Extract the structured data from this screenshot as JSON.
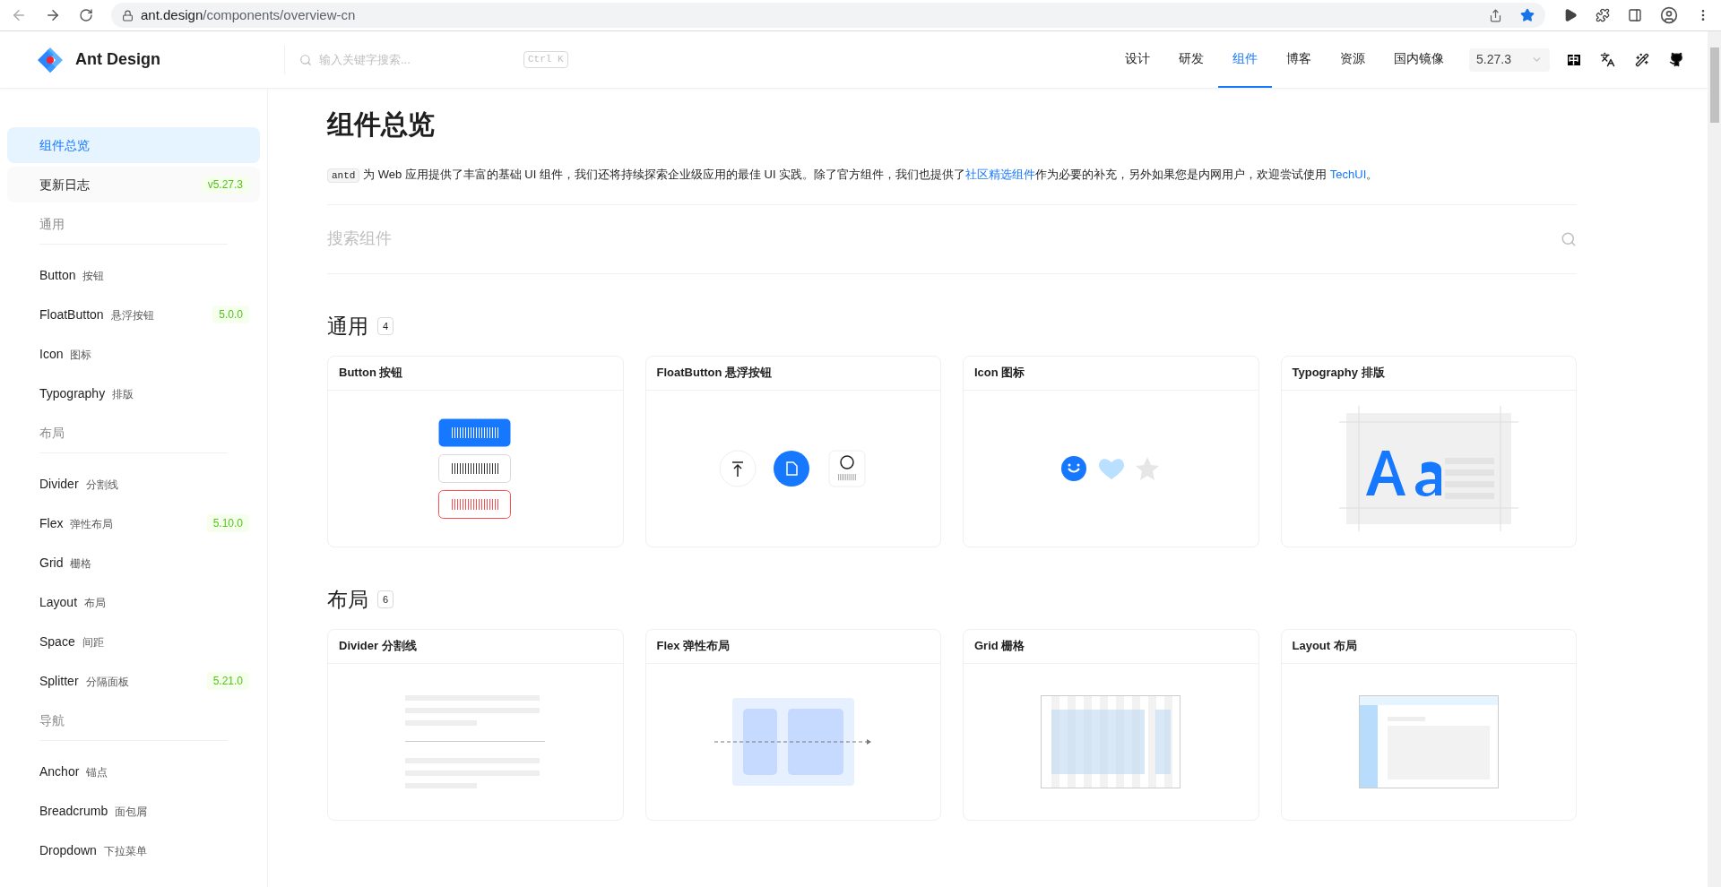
{
  "browser": {
    "url_host": "ant.design",
    "url_path": "/components/overview-cn"
  },
  "header": {
    "logo": "Ant Design",
    "search_placeholder": "输入关键字搜索...",
    "shortcut": "Ctrl K",
    "nav": [
      {
        "label": "设计",
        "selected": false
      },
      {
        "label": "研发",
        "selected": false
      },
      {
        "label": "组件",
        "selected": true
      },
      {
        "label": "博客",
        "selected": false
      },
      {
        "label": "资源",
        "selected": false
      },
      {
        "label": "国内镜像",
        "selected": false
      }
    ],
    "version": "5.27.3",
    "lang_glyph": "中"
  },
  "sidebar": {
    "items": [
      {
        "kind": "item",
        "label": "组件总览",
        "selected": true
      },
      {
        "kind": "item",
        "label": "更新日志",
        "badge": "v5.27.3",
        "selected": false
      },
      {
        "kind": "group",
        "label": "通用"
      },
      {
        "kind": "item",
        "label": "Button",
        "sub": "按钮",
        "selected": false
      },
      {
        "kind": "item",
        "label": "FloatButton",
        "sub": "悬浮按钮",
        "badge": "5.0.0",
        "selected": false
      },
      {
        "kind": "item",
        "label": "Icon",
        "sub": "图标",
        "selected": false
      },
      {
        "kind": "item",
        "label": "Typography",
        "sub": "排版",
        "selected": false
      },
      {
        "kind": "group",
        "label": "布局"
      },
      {
        "kind": "item",
        "label": "Divider",
        "sub": "分割线",
        "selected": false
      },
      {
        "kind": "item",
        "label": "Flex",
        "sub": "弹性布局",
        "badge": "5.10.0",
        "selected": false
      },
      {
        "kind": "item",
        "label": "Grid",
        "sub": "栅格",
        "selected": false
      },
      {
        "kind": "item",
        "label": "Layout",
        "sub": "布局",
        "selected": false
      },
      {
        "kind": "item",
        "label": "Space",
        "sub": "间距",
        "selected": false
      },
      {
        "kind": "item",
        "label": "Splitter",
        "sub": "分隔面板",
        "badge": "5.21.0",
        "selected": false
      },
      {
        "kind": "group",
        "label": "导航"
      },
      {
        "kind": "item",
        "label": "Anchor",
        "sub": "锚点",
        "selected": false
      },
      {
        "kind": "item",
        "label": "Breadcrumb",
        "sub": "面包屑",
        "selected": false
      },
      {
        "kind": "item",
        "label": "Dropdown",
        "sub": "下拉菜单",
        "selected": false
      }
    ]
  },
  "content": {
    "title": "组件总览",
    "description": [
      {
        "kind": "code",
        "text": "antd"
      },
      {
        "kind": "text",
        "text": " 为 Web 应用提供了丰富的基础 UI 组件，我们还将持续探索企业级应用的最佳 UI 实践。除了官方组件，我们也提供了"
      },
      {
        "kind": "link",
        "text": "社区精选组件"
      },
      {
        "kind": "text",
        "text": "作为必要的补充，另外如果您是内网用户，欢迎尝试使用 "
      },
      {
        "kind": "link",
        "text": "TechUI"
      },
      {
        "kind": "text",
        "text": "。"
      }
    ],
    "search_placeholder": "搜索组件",
    "sections": [
      {
        "title": "通用",
        "count": "4",
        "cards": [
          {
            "title": "Button 按钮",
            "kind": "button"
          },
          {
            "title": "FloatButton 悬浮按钮",
            "kind": "floatbutton"
          },
          {
            "title": "Icon 图标",
            "kind": "icon"
          },
          {
            "title": "Typography 排版",
            "kind": "typography"
          }
        ]
      },
      {
        "title": "布局",
        "count": "6",
        "cards": [
          {
            "title": "Divider 分割线",
            "kind": "divider"
          },
          {
            "title": "Flex 弹性布局",
            "kind": "flex"
          },
          {
            "title": "Grid 栅格",
            "kind": "grid"
          },
          {
            "title": "Layout 布局",
            "kind": "layout"
          }
        ]
      }
    ]
  }
}
